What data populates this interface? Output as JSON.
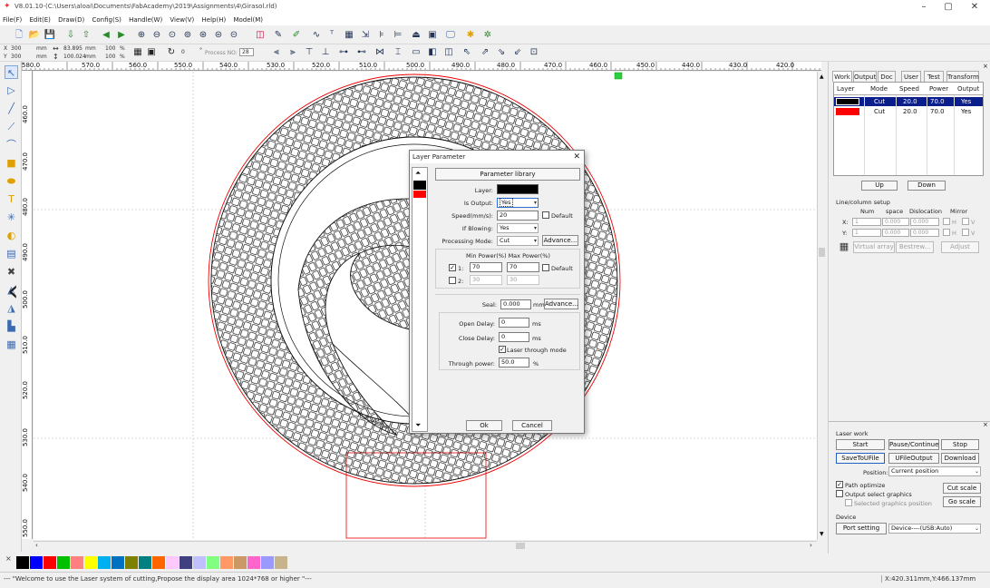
{
  "window": {
    "title": "V8.01.10-(C:\\Users\\aloai\\Documents\\FabAcademy\\2019\\Assignments\\4\\Girasol.rld)"
  },
  "menu": [
    "File(F)",
    "Edit(E)",
    "Draw(D)",
    "Config(S)",
    "Handle(W)",
    "View(V)",
    "Help(H)",
    "Model(M)"
  ],
  "toolbar2": {
    "x_label": "X",
    "x_value": "300",
    "x_unit": "mm",
    "y_label": "Y",
    "y_value": "300",
    "y_unit": "mm",
    "w_value": "83.895",
    "w_unit": "mm",
    "h_value": "100.024",
    "h_unit": "mm",
    "pct1": "100",
    "pct2": "100",
    "pct_sym": "%",
    "rotate_value": "0",
    "deg": "°",
    "process_label": "Process NO:",
    "process_value": "28"
  },
  "ruler": {
    "h_labels": [
      "580.0",
      "570.0",
      "560.0",
      "550.0",
      "540.0",
      "530.0",
      "520.0",
      "510.0",
      "500.0",
      "490.0",
      "480.0",
      "470.0",
      "460.0",
      "450.0",
      "440.0",
      "430.0",
      "420.0"
    ],
    "v_labels": [
      "460.0",
      "470.0",
      "480.0",
      "490.0",
      "500.0",
      "510.0",
      "520.0",
      "530.0",
      "540.0",
      "550.0"
    ]
  },
  "dialog": {
    "title": "Layer Parameter",
    "param_library": "Parameter library",
    "layer_label": "Layer:",
    "layer_color": "#000000",
    "is_output_label": "Is Output:",
    "is_output_value": "Yes",
    "speed_label": "Speed(mm/s):",
    "speed_value": "20",
    "default_label": "Default",
    "blowing_label": "If Blowing:",
    "blowing_value": "Yes",
    "mode_label": "Processing Mode:",
    "mode_value": "Cut",
    "advance_label": "Advance...",
    "power_header": "Min Power(%) Max Power(%)",
    "power1_label": "1:",
    "power1_min": "70",
    "power1_max": "70",
    "power2_label": "2:",
    "power2_min": "30",
    "power2_max": "30",
    "seal_label": "Seal:",
    "seal_value": "0.000",
    "seal_unit": "mm",
    "open_delay_label": "Open Delay:",
    "open_delay_value": "0",
    "close_delay_label": "Close Delay:",
    "close_delay_value": "0",
    "ms": "ms",
    "laser_through_label": "Laser through mode",
    "through_power_label": "Through power:",
    "through_power_value": "50.0",
    "pct": "%",
    "ok": "Ok",
    "cancel": "Cancel",
    "layer_swatches": [
      "#000000",
      "#ff0000"
    ]
  },
  "right_panel": {
    "tabs": [
      "Work",
      "Output",
      "Doc",
      "User",
      "Test",
      "Transform"
    ],
    "layer_headers": [
      "Layer",
      "Mode",
      "Speed",
      "Power",
      "Output"
    ],
    "layers": [
      {
        "color": "#000000",
        "mode": "Cut",
        "speed": "20.0",
        "power": "70.0",
        "output": "Yes",
        "selected": true
      },
      {
        "color": "#ff0000",
        "mode": "Cut",
        "speed": "20.0",
        "power": "70.0",
        "output": "Yes",
        "selected": false
      }
    ],
    "up": "Up",
    "down": "Down",
    "line_column_label": "Line/column setup",
    "lc_headers": [
      "Num",
      "space",
      "Dislocation",
      "Mirror"
    ],
    "x_label": "X:",
    "x_num": "1",
    "x_space": "0.000",
    "x_disloc": "0.000",
    "y_label": "Y:",
    "y_num": "1",
    "y_space": "0.000",
    "y_disloc": "0.000",
    "mirror_h": "H",
    "mirror_v": "V",
    "virtual_array": "Virtual array",
    "bestrew": "Bestrew...",
    "adjust": "Adjust",
    "laser_work_label": "Laser work",
    "start": "Start",
    "pause": "Pause/Continue",
    "stop": "Stop",
    "save_to_ufile": "SaveToUFile",
    "ufile_output": "UFileOutput",
    "download": "Download",
    "position_label": "Position:",
    "position_value": "Current position",
    "path_optimize": "Path optimize",
    "output_select": "Output select graphics",
    "selected_pos": "Selected graphics position",
    "cut_scale": "Cut scale",
    "go_scale": "Go scale",
    "device_label": "Device",
    "port_setting": "Port setting",
    "device_value": "Device----(USB:Auto)"
  },
  "palette": [
    "#000000",
    "#0000ff",
    "#ff0000",
    "#00c000",
    "#ff8080",
    "#ffff00",
    "#00b0f0",
    "#0070c0",
    "#808000",
    "#008080",
    "#ff6600",
    "#ffc8ff",
    "#404080",
    "#c0c0ff",
    "#80ff80",
    "#ff9966",
    "#cc9966",
    "#ff66cc",
    "#9999ff",
    "#c8b48c"
  ],
  "status": {
    "message": "--- \"Welcome to use the Laser system of cutting,Propose the display area 1024*768 or higher \"---",
    "coords": "X:420.311mm,Y:466.137mm"
  }
}
